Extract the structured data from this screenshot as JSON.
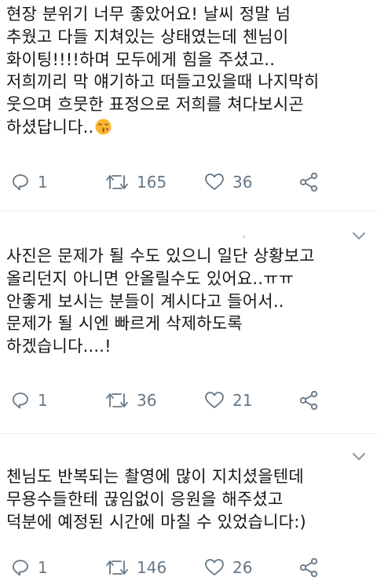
{
  "tweets": [
    {
      "text": "현장 분위기 너무 좋았어요! 날씨 정말 넘\n추웠고 다들 지쳐있는 상태였는데 첸님이\n화이팅!!!!하며 모두에게 힘을 주셨고..\n저희끼리 막 얘기하고 떠들고있을때 나지막히\n웃으며 흐뭇한 표정으로 저희를 쳐다보시곤\n하셨답니다..",
      "emoji": "kissing-face-emoji",
      "replies": "1",
      "retweets": "165",
      "likes": "36"
    },
    {
      "text": "사진은 문제가 될 수도 있으니 일단 상황보고\n올리던지 아니면 안올릴수도 있어요..ㅠㅠ\n안좋게 보시는 분들이 계시다고 들어서..\n문제가 될 시엔 빠르게 삭제하도록\n하겠습니다....!",
      "replies": "1",
      "retweets": "36",
      "likes": "21"
    },
    {
      "text": "첸님도 반복되는 촬영에 많이 지치셨을텐데\n무용수들한테 끊임없이 응원을 해주셨고\n덕분에 예정된 시간에 마칠 수 있었습니다:)",
      "replies": "1",
      "retweets": "146",
      "likes": "26"
    }
  ],
  "icons": [
    "reply-icon",
    "retweet-icon",
    "like-icon",
    "share-icon",
    "chevron-down-icon"
  ],
  "colors": {
    "text": "#14171a",
    "icon": "#657786",
    "divider": "#e6ecf0",
    "emoji": "#f7b733"
  }
}
